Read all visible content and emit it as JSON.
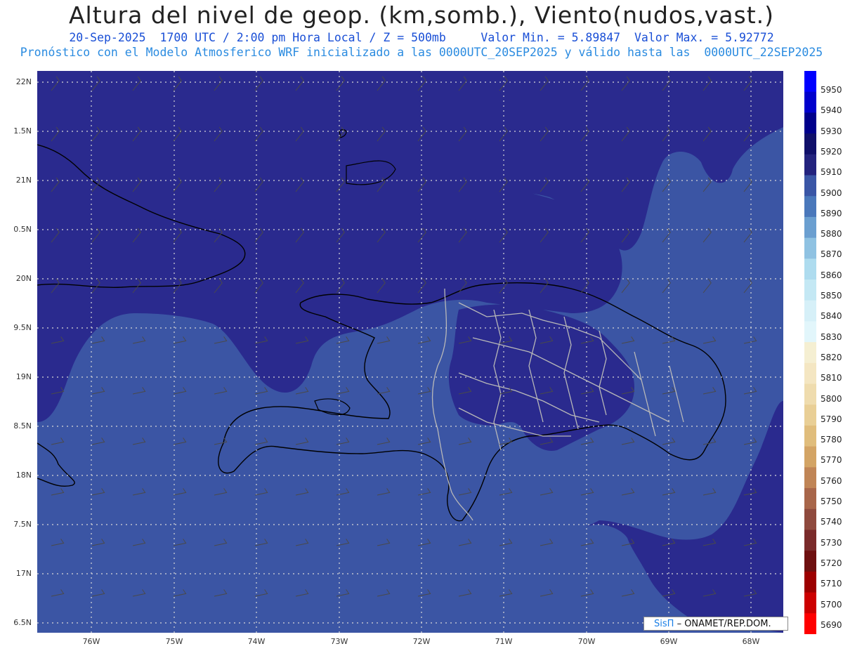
{
  "header": {
    "title": "Altura del nivel de geop. (km,somb.), Viento(nudos,vast.)",
    "subtitle_1": "20-Sep-2025  1700 UTC / 2:00 pm Hora Local / Z = 500mb     Valor Min. = 5.89847  Valor Max. = 5.92772",
    "subtitle_2": "Pronóstico con el Modelo Atmosferico WRF inicializado a las 0000UTC_20SEP2025 y válido hasta las  0000UTC_22SEP2025"
  },
  "map": {
    "lat_labels": [
      "22N",
      "1.5N",
      "21N",
      "0.5N",
      "20N",
      "9.5N",
      "19N",
      "8.5N",
      "18N",
      "7.5N",
      "17N",
      "6.5N"
    ],
    "lon_labels": [
      "76W",
      "75W",
      "74W",
      "73W",
      "72W",
      "71W",
      "70W",
      "69W",
      "68W"
    ],
    "colors": {
      "fill_5910": "#2a2a8e",
      "fill_5900": "#3b55a4",
      "coast": "#000000",
      "province_borders": "#b8b8b8",
      "grid": "#d8d8d8"
    }
  },
  "colorbar": {
    "levels": [
      "5950",
      "5940",
      "5930",
      "5920",
      "5910",
      "5900",
      "5890",
      "5880",
      "5870",
      "5860",
      "5850",
      "5840",
      "5830",
      "5820",
      "5810",
      "5800",
      "5790",
      "5780",
      "5770",
      "5760",
      "5750",
      "5740",
      "5730",
      "5720",
      "5710",
      "5700",
      "5690"
    ],
    "colors": [
      "#0000ff",
      "#0000cc",
      "#00008b",
      "#10106a",
      "#23237e",
      "#3a56a6",
      "#4a78bb",
      "#6b9fd0",
      "#8fc2e2",
      "#aedcef",
      "#c4e8f4",
      "#d6f0f8",
      "#e2f6fb",
      "#f5efd2",
      "#f4e6c2",
      "#efdcae",
      "#e9cf96",
      "#e0bd7c",
      "#d3a465",
      "#c08556",
      "#a8664a",
      "#8f4a3e",
      "#7a2b2b",
      "#6e1010",
      "#9c0000",
      "#cc0000",
      "#ff0000"
    ]
  },
  "credit": {
    "brand": "SisΠ",
    "text": "– ONAMET/REP.DOM."
  }
}
